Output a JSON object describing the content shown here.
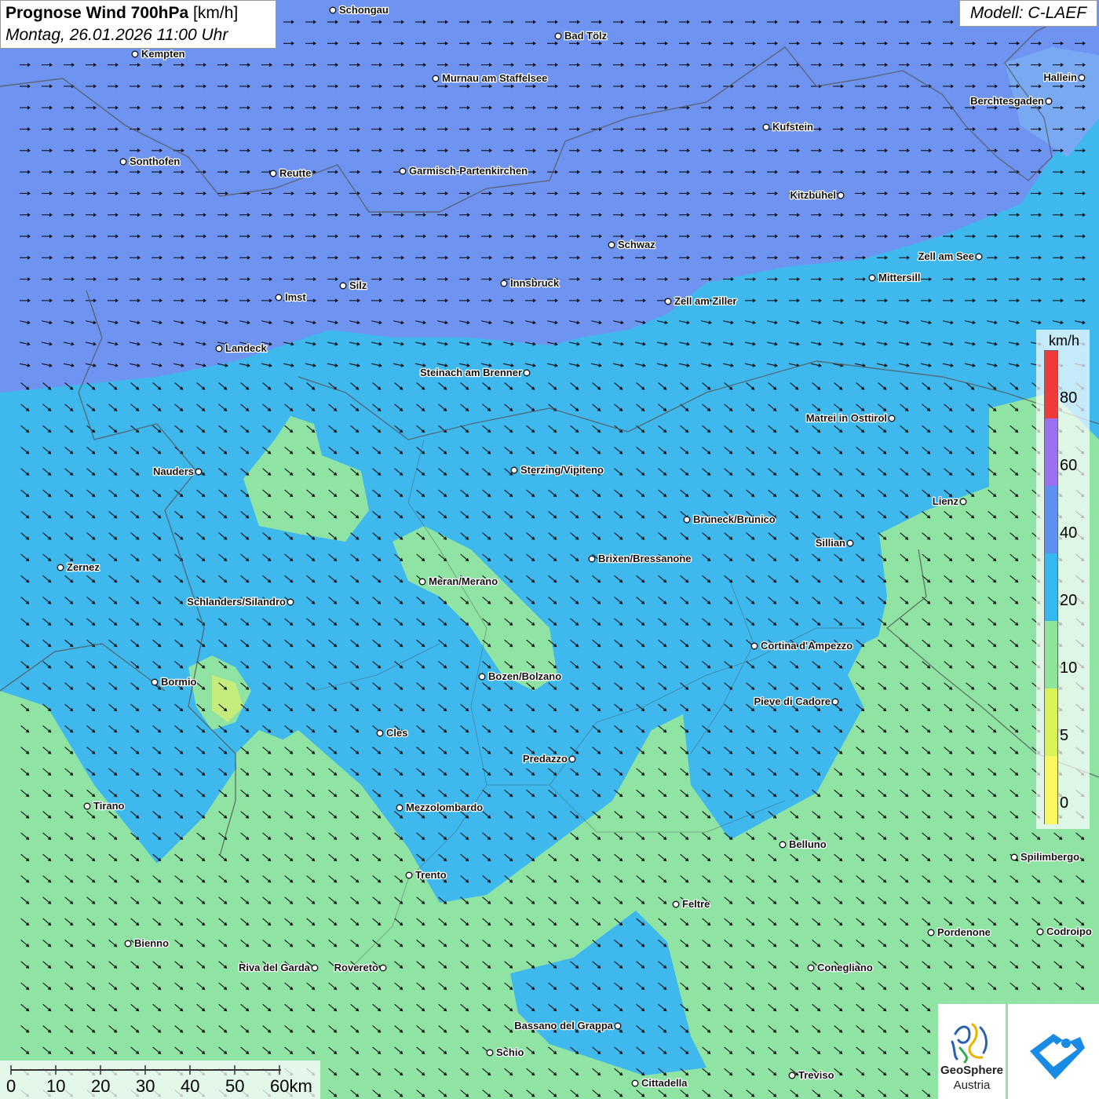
{
  "header": {
    "title_bold": "Prognose Wind 700hPa",
    "title_unit": "[km/h]",
    "datetime": "Montag, 26.01.2026 11:00 Uhr",
    "model": "Modell: C-LAEF"
  },
  "legend": {
    "unit": "km/h",
    "ticks": [
      "80",
      "60",
      "40",
      "20",
      "10",
      "5",
      "0"
    ],
    "colors": [
      "#ef3a3a",
      "#9a6ff0",
      "#5f8ff0",
      "#34b8ef",
      "#8ee59a",
      "#d9f25a",
      "#fbf760"
    ]
  },
  "wind_field": {
    "colors": {
      "band_30_40": "#6f93f0",
      "band_20_30": "#3fb8ee",
      "band_10_20": "#8fe3a3",
      "band_5_10": "#c7ec7e"
    },
    "arrow_direction_north": "east",
    "arrow_direction_south": "south-east"
  },
  "cities": [
    {
      "name": "Schongau",
      "side": "right"
    },
    {
      "name": "Bad Tölz",
      "side": "right"
    },
    {
      "name": "Kempten",
      "side": "right"
    },
    {
      "name": "Murnau am Staffelsee",
      "side": "right"
    },
    {
      "name": "Hallein",
      "side": "left"
    },
    {
      "name": "Berchtesgaden",
      "side": "left"
    },
    {
      "name": "Kufstein",
      "side": "right"
    },
    {
      "name": "Sonthofen",
      "side": "right"
    },
    {
      "name": "Reutte",
      "side": "right"
    },
    {
      "name": "Garmisch-Partenkirchen",
      "side": "right"
    },
    {
      "name": "Kitzbühel",
      "side": "left"
    },
    {
      "name": "Schwaz",
      "side": "right"
    },
    {
      "name": "Zell am See",
      "side": "left"
    },
    {
      "name": "Mittersill",
      "side": "right"
    },
    {
      "name": "Silz",
      "side": "right"
    },
    {
      "name": "Innsbruck",
      "side": "right"
    },
    {
      "name": "Imst",
      "side": "right"
    },
    {
      "name": "Zell am Ziller",
      "side": "right"
    },
    {
      "name": "Landeck",
      "side": "right"
    },
    {
      "name": "Steinach am Brenner",
      "side": "left"
    },
    {
      "name": "Matrei in Osttirol",
      "side": "left"
    },
    {
      "name": "Nauders",
      "side": "left"
    },
    {
      "name": "Sterzing/Vipiteno",
      "side": "right"
    },
    {
      "name": "Lienz",
      "side": "left"
    },
    {
      "name": "Bruneck/Brunico",
      "side": "right"
    },
    {
      "name": "Sillian",
      "side": "left"
    },
    {
      "name": "Zernez",
      "side": "right"
    },
    {
      "name": "Brixen/Bressanone",
      "side": "right"
    },
    {
      "name": "Meran/Merano",
      "side": "right"
    },
    {
      "name": "Schlanders/Silandro",
      "side": "left"
    },
    {
      "name": "Cortina d'Ampezzo",
      "side": "right"
    },
    {
      "name": "Bozen/Bolzano",
      "side": "right"
    },
    {
      "name": "Bormio",
      "side": "right"
    },
    {
      "name": "Pieve di Cadore",
      "side": "left"
    },
    {
      "name": "Cles",
      "side": "right"
    },
    {
      "name": "Predazzo",
      "side": "left"
    },
    {
      "name": "Tirano",
      "side": "right"
    },
    {
      "name": "Mezzolombardo",
      "side": "right"
    },
    {
      "name": "Belluno",
      "side": "right"
    },
    {
      "name": "Spilimbergo",
      "side": "right"
    },
    {
      "name": "Trento",
      "side": "right"
    },
    {
      "name": "Feltre",
      "side": "right"
    },
    {
      "name": "Pordenone",
      "side": "right"
    },
    {
      "name": "Codroipo",
      "side": "right"
    },
    {
      "name": "Bienno",
      "side": "right"
    },
    {
      "name": "Riva del Garda",
      "side": "left"
    },
    {
      "name": "Rovereto",
      "side": "left"
    },
    {
      "name": "Conegliano",
      "side": "right"
    },
    {
      "name": "Bassano del Grappa",
      "side": "left"
    },
    {
      "name": "Schio",
      "side": "right"
    },
    {
      "name": "Treviso",
      "side": "right"
    },
    {
      "name": "Cittadella",
      "side": "right"
    }
  ],
  "scale_bar": {
    "labels": [
      "0",
      "10",
      "20",
      "30",
      "40",
      "50",
      "60km"
    ]
  },
  "logos": {
    "geosphere_line1": "GeoSphere",
    "geosphere_line2": "Austria"
  }
}
